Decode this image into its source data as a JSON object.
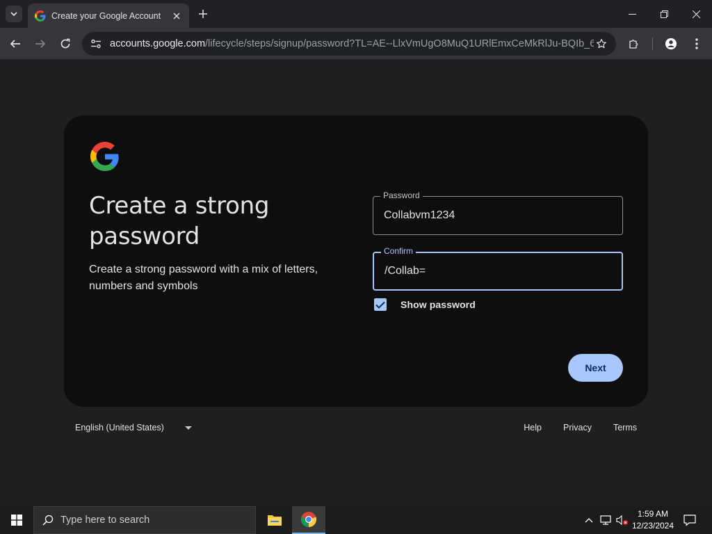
{
  "browser": {
    "tab": {
      "title": "Create your Google Account"
    },
    "address_bar": {
      "host": "accounts.google.com",
      "path": "/lifecycle/steps/signup/password?TL=AE--LlxVmUgO8MuQ1URlEmxCeMkRlJu-BQIb_6p..."
    }
  },
  "page": {
    "heading": "Create a strong password",
    "subtext": "Create a strong password with a mix of letters, numbers and symbols",
    "password_field": {
      "label": "Password",
      "value": "Collabvm1234"
    },
    "confirm_field": {
      "label": "Confirm",
      "value": "/Collab="
    },
    "show_password": {
      "label": "Show password",
      "checked": true
    },
    "next_button": "Next"
  },
  "footer": {
    "language": "English (United States)",
    "links": [
      "Help",
      "Privacy",
      "Terms"
    ]
  },
  "taskbar": {
    "search_placeholder": "Type here to search",
    "time": "1:59 AM",
    "date": "12/23/2024"
  },
  "colors": {
    "accent": "#a8c7fa",
    "button_text": "#062e6f",
    "card_bg": "#0e0e0e",
    "page_bg": "#1f1f1f"
  }
}
